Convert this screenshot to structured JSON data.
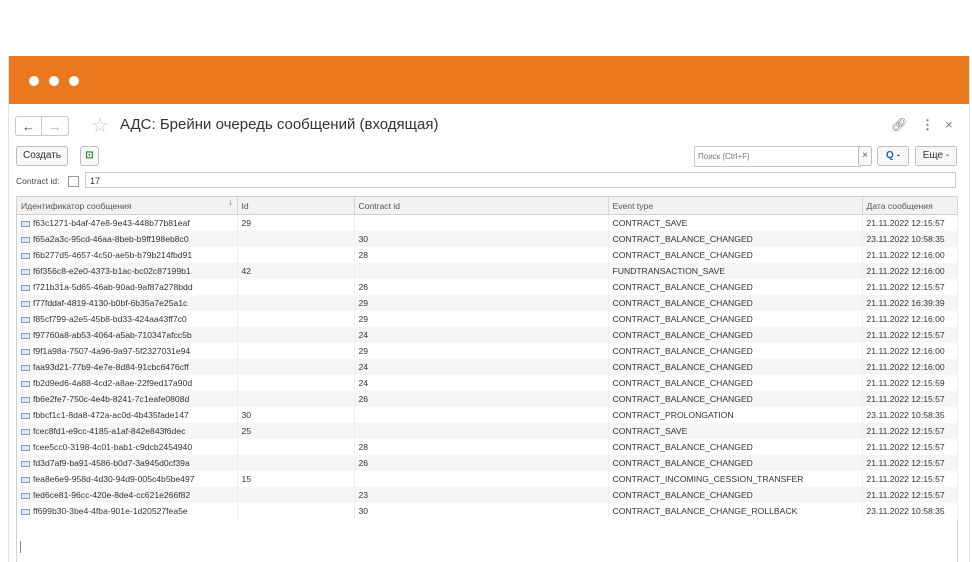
{
  "header": {
    "title": "АДС: Брейни очередь сообщений (входящая)",
    "back_label": "←",
    "forward_label": "→",
    "link_icon": "link-icon",
    "more_icon": "vertical-dots-icon",
    "close_icon": "close-icon"
  },
  "toolbar": {
    "create_label": "Создать",
    "search_placeholder": "Поиск (Ctrl+F)",
    "clear_label": "×",
    "search_label": "Q -",
    "more_label": "Еще -"
  },
  "filter": {
    "label": "Contract id:",
    "checked": false,
    "value": "17"
  },
  "table": {
    "columns": [
      "Идентификатор сообщения",
      "Id",
      "Contract id",
      "Event type",
      "Дата сообщения"
    ],
    "sort_indicator": "↓",
    "rows": [
      [
        "f63c1271-b4af-47e8-9e43-448b77b81eaf",
        "29",
        "",
        "CONTRACT_SAVE",
        "21.11.2022 12:15:57"
      ],
      [
        "f65a2a3c-95cd-46aa-8beb-b9ff198eb8c0",
        "",
        "30",
        "CONTRACT_BALANCE_CHANGED",
        "23.11.2022 10:58:35"
      ],
      [
        "f6b277d5-4657-4c50-ae5b-b79b214fbd91",
        "",
        "28",
        "CONTRACT_BALANCE_CHANGED",
        "21.11.2022 12:16:00"
      ],
      [
        "f6f356c8-e2e0-4373-b1ac-bc02c87199b1",
        "42",
        "",
        "FUNDTRANSACTION_SAVE",
        "21.11.2022 12:16:00"
      ],
      [
        "f721b31a-5d65-46ab-90ad-9af87a278bdd",
        "",
        "26",
        "CONTRACT_BALANCE_CHANGED",
        "21.11.2022 12:15:57"
      ],
      [
        "f77fddaf-4819-4130-b0bf-6b35a7e25a1c",
        "",
        "29",
        "CONTRACT_BALANCE_CHANGED",
        "21.11.2022 16:39:39"
      ],
      [
        "f85cf799-a2e5-45b8-bd33-424aa43ff7c0",
        "",
        "29",
        "CONTRACT_BALANCE_CHANGED",
        "21.11.2022 12:16:00"
      ],
      [
        "f97760a8-ab53-4064-a5ab-710347afcc5b",
        "",
        "24",
        "CONTRACT_BALANCE_CHANGED",
        "21.11.2022 12:15:57"
      ],
      [
        "f9f1a98a-7507-4a96-9a97-5f2327031e94",
        "",
        "29",
        "CONTRACT_BALANCE_CHANGED",
        "21.11.2022 12:16:00"
      ],
      [
        "faa93d21-77b9-4e7e-8d84-91cbc6476cff",
        "",
        "24",
        "CONTRACT_BALANCE_CHANGED",
        "21.11.2022 12:16:00"
      ],
      [
        "fb2d9ed6-4a88-4cd2-a8ae-22f9ed17a90d",
        "",
        "24",
        "CONTRACT_BALANCE_CHANGED",
        "21.11.2022 12:15:59"
      ],
      [
        "fb6e2fe7-750c-4e4b-8241-7c1eafe0808d",
        "",
        "26",
        "CONTRACT_BALANCE_CHANGED",
        "21.11.2022 12:15:57"
      ],
      [
        "fbbcf1c1-8da8-472a-ac0d-4b435fade147",
        "30",
        "",
        "CONTRACT_PROLONGATION",
        "23.11.2022 10:58:35"
      ],
      [
        "fcec8fd1-e9cc-4185-a1af-842e843f6dec",
        "25",
        "",
        "CONTRACT_SAVE",
        "21.11.2022 12:15:57"
      ],
      [
        "fcee5cc0-3198-4c01-bab1-c9dcb2454940",
        "",
        "28",
        "CONTRACT_BALANCE_CHANGED",
        "21.11.2022 12:15:57"
      ],
      [
        "fd3d7af9-ba91-4586-b0d7-3a945d0cf39a",
        "",
        "26",
        "CONTRACT_BALANCE_CHANGED",
        "21.11.2022 12:15:57"
      ],
      [
        "fea8e6e9-958d-4d30-94d9-005c4b5be497",
        "15",
        "",
        "CONTRACT_INCOMING_CESSION_TRANSFER",
        "21.11.2022 12:15:57"
      ],
      [
        "fed6ce81-96cc-420e-8de4-cc621e266f82",
        "",
        "23",
        "CONTRACT_BALANCE_CHANGED",
        "21.11.2022 12:15:57"
      ],
      [
        "ff699b30-3be4-4fba-901e-1d20527fea5e",
        "",
        "30",
        "CONTRACT_BALANCE_CHANGE_ROLLBACK",
        "23.11.2022 10:58:35"
      ]
    ]
  },
  "colors": {
    "titlebar": "#e9781f",
    "row_alt": "#f6f6f6"
  }
}
